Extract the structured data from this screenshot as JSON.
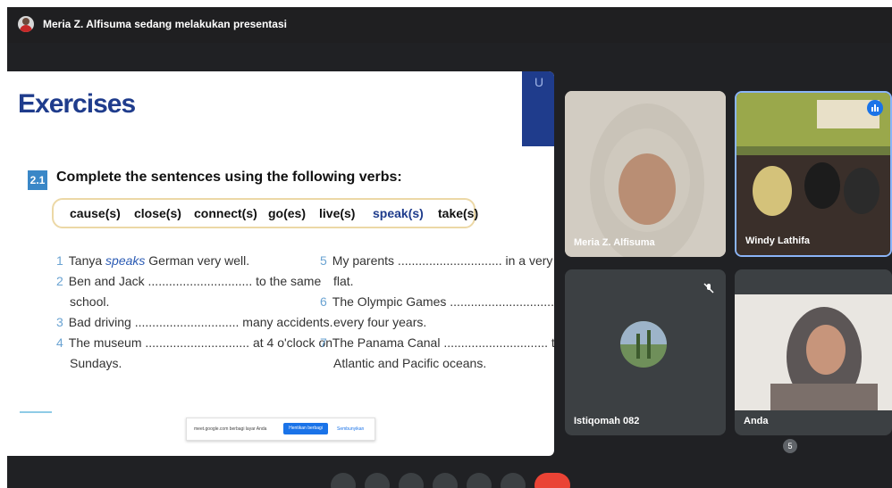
{
  "presenter_bar": {
    "text": "Meria Z. Alfisuma sedang melakukan presentasi"
  },
  "slide": {
    "title": "Exercises",
    "section_number": "2.1",
    "instruction": "Complete the sentences using the following verbs:",
    "verbs": [
      "cause(s)",
      "close(s)",
      "connect(s)",
      "go(es)",
      "live(s)",
      "speak(s)",
      "take(s)"
    ],
    "sentences_left": [
      {
        "num": "1",
        "parts": [
          "Tanya ",
          "speaks",
          " German very well."
        ]
      },
      {
        "num": "2",
        "line1": "Ben and Jack .............................. to the same",
        "line2": "school."
      },
      {
        "num": "3",
        "line1": "Bad driving .............................. many accidents."
      },
      {
        "num": "4",
        "line1": "The museum .............................. at 4 o'clock on",
        "line2": "Sundays."
      }
    ],
    "sentences_right": [
      {
        "num": "5",
        "line1": "My parents .............................. in a very small",
        "line2": "flat."
      },
      {
        "num": "6",
        "line1": "The Olympic Games .............................. place",
        "line2": "every four years."
      },
      {
        "num": "7",
        "line1": "The Panama Canal .............................. the",
        "line2": "Atlantic and Pacific oceans."
      }
    ],
    "share_bar": {
      "text": "meet.google.com berbagi layar Anda",
      "stop_label": "Hentikan berbagi",
      "hide_label": "Sembunyikan"
    }
  },
  "participants": [
    {
      "name": "Meria Z. Alfisuma"
    },
    {
      "name": "Windy Lathifa"
    },
    {
      "name": "Istiqomah 082"
    },
    {
      "name": "Anda"
    }
  ],
  "controls": {
    "participant_count": "5"
  }
}
